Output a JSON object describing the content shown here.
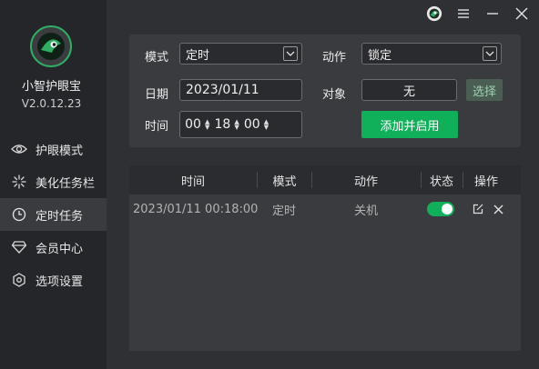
{
  "app": {
    "name": "小智护眼宝",
    "version": "V2.0.12.23"
  },
  "sidebar": {
    "items": [
      {
        "label": "护眼模式",
        "icon": "eye-icon"
      },
      {
        "label": "美化任务栏",
        "icon": "sparkle-icon"
      },
      {
        "label": "定时任务",
        "icon": "clock-icon",
        "active": true
      },
      {
        "label": "会员中心",
        "icon": "diamond-icon"
      },
      {
        "label": "选项设置",
        "icon": "settings-icon"
      }
    ]
  },
  "window_controls": [
    "avatar-icon",
    "menu-icon",
    "minimize-icon",
    "close-icon"
  ],
  "form": {
    "mode_label": "模式",
    "mode_value": "定时",
    "action_label": "动作",
    "action_value": "锁定",
    "date_label": "日期",
    "date_value": "2023/01/11",
    "target_label": "对象",
    "target_value": "无",
    "select_button": "选择",
    "time_label": "时间",
    "time_hour": "00",
    "time_minute": "18",
    "time_second": "00",
    "add_button": "添加并启用"
  },
  "table": {
    "headers": [
      "时间",
      "模式",
      "动作",
      "状态",
      "操作"
    ],
    "rows": [
      {
        "time": "2023/01/11 00:18:00",
        "mode": "定时",
        "action": "关机",
        "enabled": true
      }
    ]
  },
  "colors": {
    "accent": "#10b05a",
    "background": "#2f3034",
    "sidebar": "#25262a",
    "panel": "#3a3b3f"
  }
}
